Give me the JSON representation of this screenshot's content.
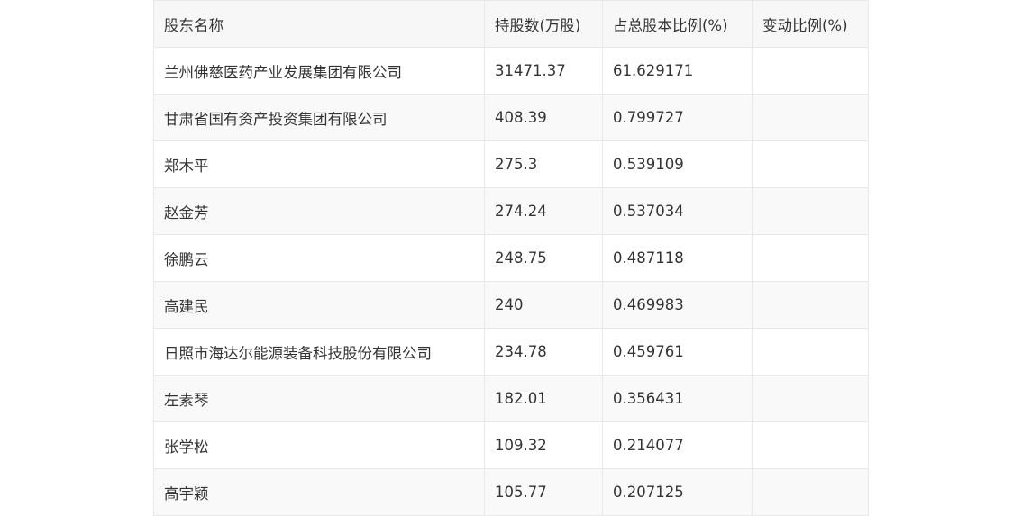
{
  "table": {
    "headers": [
      "股东名称",
      "持股数(万股)",
      "占总股本比例(%)",
      "变动比例(%)"
    ],
    "rows": [
      {
        "name": "兰州佛慈医药产业发展集团有限公司",
        "shares": "31471.37",
        "ratio": "61.629171",
        "change": ""
      },
      {
        "name": "甘肃省国有资产投资集团有限公司",
        "shares": "408.39",
        "ratio": "0.799727",
        "change": ""
      },
      {
        "name": "郑木平",
        "shares": "275.3",
        "ratio": "0.539109",
        "change": ""
      },
      {
        "name": "赵金芳",
        "shares": "274.24",
        "ratio": "0.537034",
        "change": ""
      },
      {
        "name": "徐鹏云",
        "shares": "248.75",
        "ratio": "0.487118",
        "change": ""
      },
      {
        "name": "高建民",
        "shares": "240",
        "ratio": "0.469983",
        "change": ""
      },
      {
        "name": "日照市海达尔能源装备科技股份有限公司",
        "shares": "234.78",
        "ratio": "0.459761",
        "change": ""
      },
      {
        "name": "左素琴",
        "shares": "182.01",
        "ratio": "0.356431",
        "change": ""
      },
      {
        "name": "张学松",
        "shares": "109.32",
        "ratio": "0.214077",
        "change": ""
      },
      {
        "name": "高宇颖",
        "shares": "105.77",
        "ratio": "0.207125",
        "change": ""
      }
    ]
  }
}
